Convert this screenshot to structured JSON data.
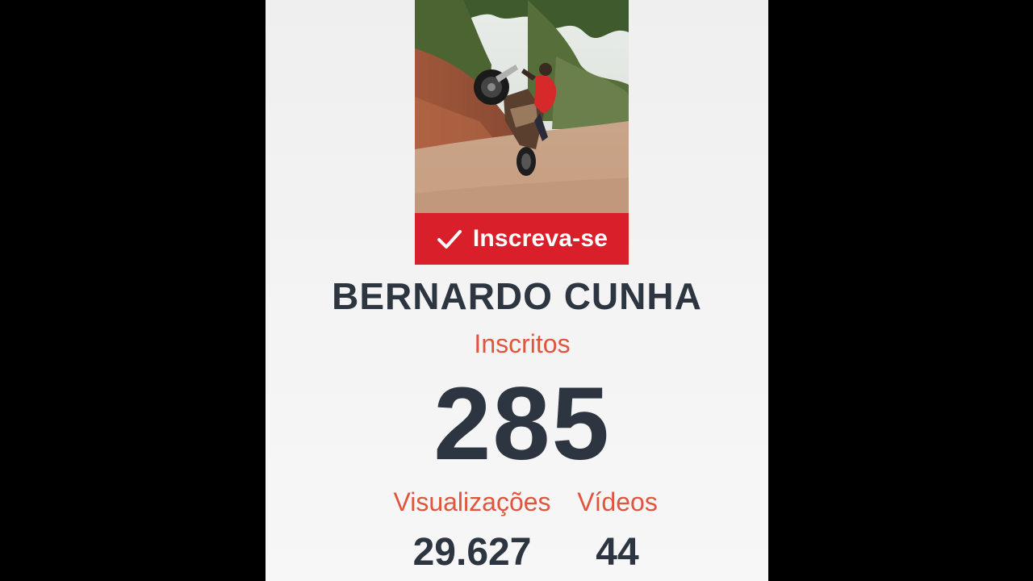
{
  "subscribe_button": {
    "label": "Inscreva-se",
    "icon": "check-icon",
    "background_color": "#d9202a"
  },
  "channel": {
    "name": "BERNARDO CUNHA",
    "avatar": "motorcycle-wheelie-photo"
  },
  "subscribers": {
    "label": "Inscritos",
    "count": "285"
  },
  "stats": {
    "views": {
      "label": "Visualizações",
      "value": "29.627"
    },
    "videos": {
      "label": "Vídeos",
      "value": "44"
    }
  },
  "colors": {
    "accent": "#e0553c",
    "text_dark": "#2c3540",
    "letterbox": "#000000"
  }
}
